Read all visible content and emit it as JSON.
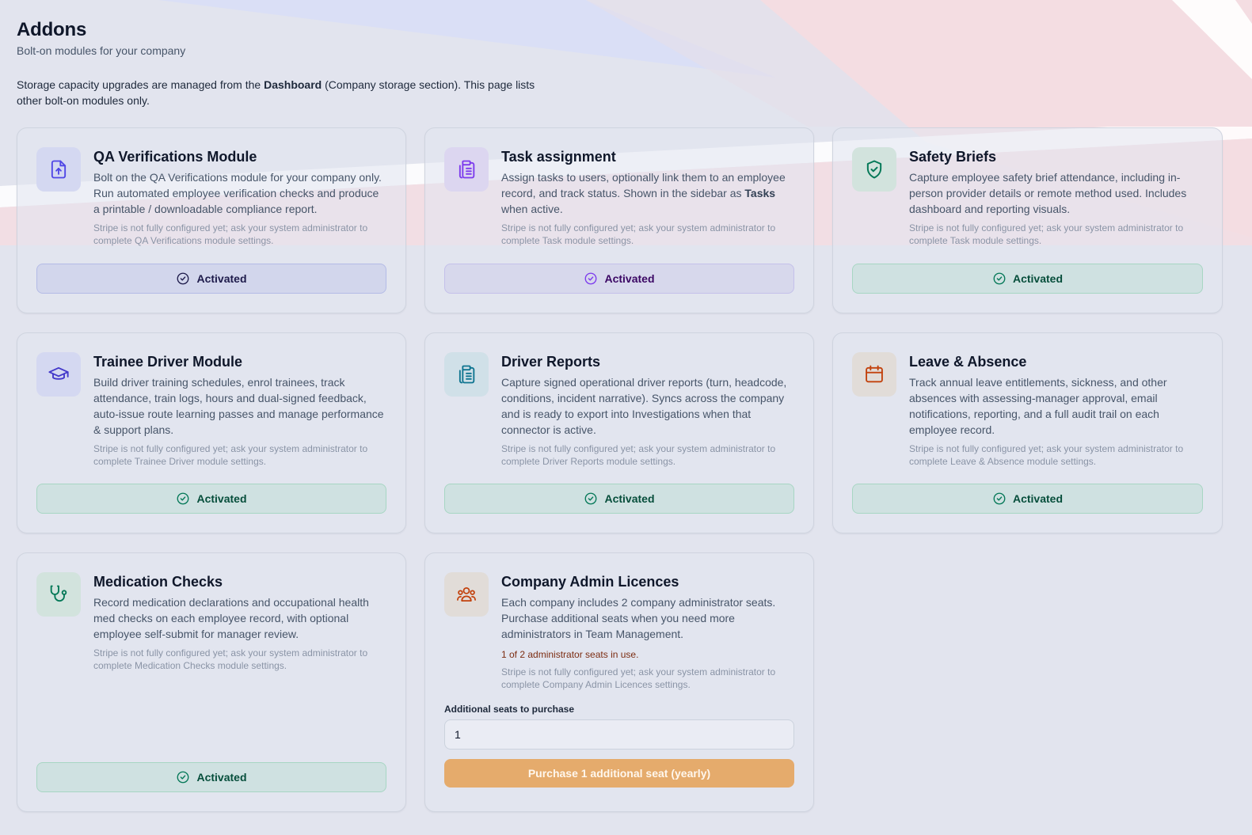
{
  "header": {
    "title": "Addons",
    "subtitle": "Bolt-on modules for your company",
    "notice_prefix": "Storage capacity upgrades are managed from the ",
    "notice_bold": "Dashboard",
    "notice_suffix": " (Company storage section). This page lists other bolt-on modules only."
  },
  "cards": [
    {
      "title": "QA Verifications Module",
      "description": "Bolt on the QA Verifications module for your company only. Run automated employee verification checks and produce a printable / downloadable compliance report.",
      "note": "Stripe is not fully configured yet; ask your system administrator to complete QA Verifications module settings.",
      "button": "Activated",
      "icon": "file-upload-icon",
      "accent": "#4f46e5"
    },
    {
      "title": "Task assignment",
      "description_prefix": "Assign tasks to users, optionally link them to an employee record, and track status. Shown in the sidebar as ",
      "description_bold": "Tasks",
      "description_suffix": " when active.",
      "note": "Stripe is not fully configured yet; ask your system administrator to complete Task module settings.",
      "button": "Activated",
      "icon": "clipboard-list-icon",
      "accent": "#7c3aed"
    },
    {
      "title": "Safety Briefs",
      "description": "Capture employee safety brief attendance, including in-person provider details or remote method used. Includes dashboard and reporting visuals.",
      "note": "Stripe is not fully configured yet; ask your system administrator to complete Task module settings.",
      "button": "Activated",
      "icon": "shield-check-icon",
      "accent": "#047857"
    },
    {
      "title": "Trainee Driver Module",
      "description": "Build driver training schedules, enrol trainees, track attendance, train logs, hours and dual-signed feedback, auto-issue route learning passes and manage performance & support plans.",
      "note": "Stripe is not fully configured yet; ask your system administrator to complete Trainee Driver module settings.",
      "button": "Activated",
      "icon": "graduation-cap-icon",
      "accent": "#4338ca"
    },
    {
      "title": "Driver Reports",
      "description": "Capture signed operational driver reports (turn, headcode, conditions, incident narrative). Syncs across the company and is ready to export into Investigations when that connector is active.",
      "note": "Stripe is not fully configured yet; ask your system administrator to complete Driver Reports module settings.",
      "button": "Activated",
      "icon": "clipboard-copy-icon",
      "accent": "#0e7490"
    },
    {
      "title": "Leave & Absence",
      "description": "Track annual leave entitlements, sickness, and other absences with assessing-manager approval, email notifications, reporting, and a full audit trail on each employee record.",
      "note": "Stripe is not fully configured yet; ask your system administrator to complete Leave & Absence module settings.",
      "button": "Activated",
      "icon": "calendar-icon",
      "accent": "#c2410c"
    },
    {
      "title": "Medication Checks",
      "description": "Record medication declarations and occupational health med checks on each employee record, with optional employee self-submit for manager review.",
      "note": "Stripe is not fully configured yet; ask your system administrator to complete Medication Checks module settings.",
      "button": "Activated",
      "icon": "stethoscope-icon",
      "accent": "#047857"
    },
    {
      "title": "Company Admin Licences",
      "description": "Each company includes 2 company administrator seats. Purchase additional seats when you need more administrators in Team Management.",
      "seats_status": "1 of 2 administrator seats in use.",
      "note": "Stripe is not fully configured yet; ask your system administrator to complete Company Admin Licences settings.",
      "field_label": "Additional seats to purchase",
      "field_value": "1",
      "button": "Purchase 1 additional seat (yearly)",
      "icon": "users-icon",
      "accent": "#c2410c"
    }
  ]
}
